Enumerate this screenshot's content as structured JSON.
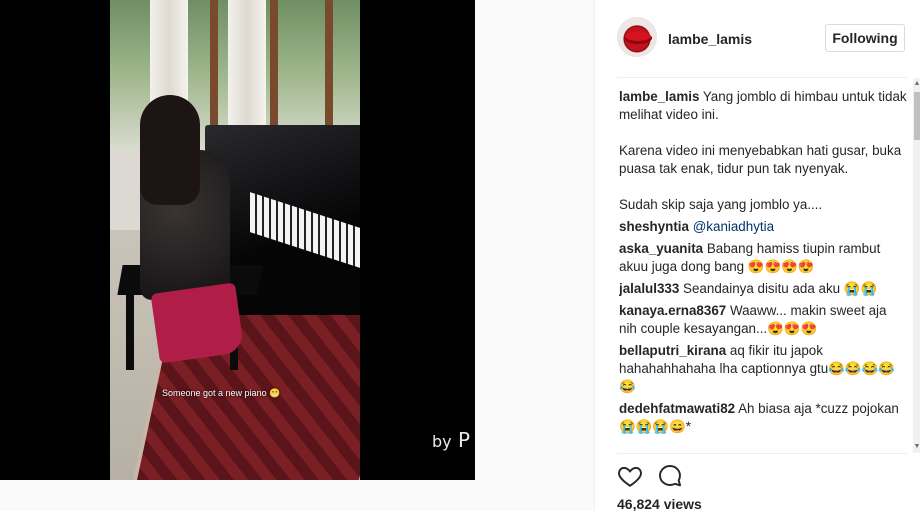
{
  "video": {
    "caption_overlay": "Someone got a new piano",
    "watermark_by": "by",
    "watermark_mark": "P"
  },
  "post": {
    "username": "lambe_lamis",
    "follow_label": "Following",
    "caption": {
      "user": "lambe_lamis",
      "paragraphs": [
        "Yang jomblo di himbau untuk tidak melihat video ini.",
        "Karena video ini menyebabkan hati gusar, buka puasa tak enak, tidur pun tak nyenyak.",
        "Sudah skip saja yang jomblo ya...."
      ]
    },
    "comments": [
      {
        "user": "sheshyntia",
        "text": "@kaniadhytia"
      },
      {
        "user": "aska_yuanita",
        "text": "Babang hamiss tiupin rambut akuu juga dong bang 😍😍😍😍"
      },
      {
        "user": "jalalul333",
        "text": "Seandainya disitu ada aku 😭😭"
      },
      {
        "user": "kanaya.erna8367",
        "text": "Waaww... makin sweet aja nih couple kesayangan...😍😍😍"
      },
      {
        "user": "bellaputri_kirana",
        "text": "aq fikir itu japok hahahahhahaha lha captionnya gtu😂😂😂😂😂"
      },
      {
        "user": "dedehfatmawati82",
        "text": "Ah biasa aja *cuzz pojokan😭😭😭😄*"
      }
    ],
    "views": "46,824 views"
  },
  "icons": {
    "like": "heart-icon",
    "comment": "comment-icon",
    "scroll_up": "▲",
    "scroll_down": "▼"
  },
  "colors": {
    "text": "#262626",
    "border": "#dbdbdb",
    "mention": "#003569"
  }
}
